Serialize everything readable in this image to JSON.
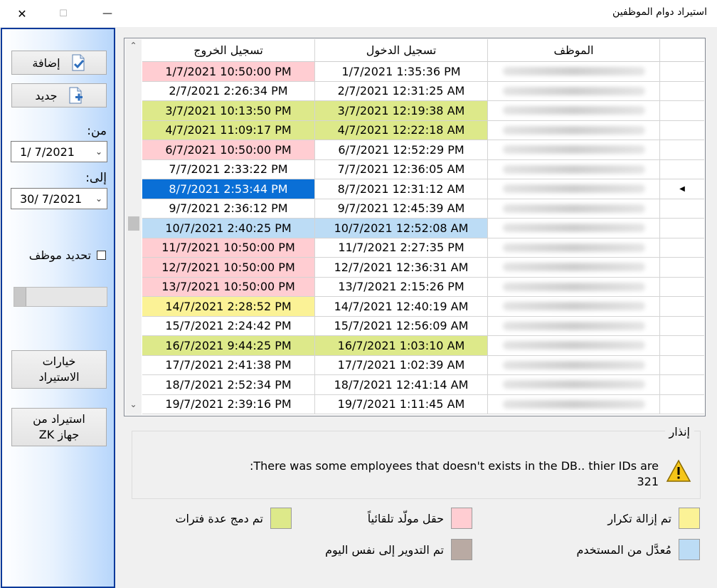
{
  "window": {
    "title": "استيراد دوام الموظفين"
  },
  "sidebar": {
    "add_label": "إضافة",
    "new_label": "جديد",
    "from_label": "من:",
    "from_date": "1/  7/2021",
    "to_label": "إلى:",
    "to_date": "30/  7/2021",
    "select_employee_label": "تحديد موظف",
    "progress_fraction": 0.12,
    "import_options_line1": "خيارات",
    "import_options_line2": "الاستيراد",
    "import_zk_line1": "استيراد من",
    "import_zk_line2": "جهاز ZK"
  },
  "grid": {
    "columns": {
      "out": "تسجيل الخروج",
      "in": "تسجيل الدخول",
      "employee": "الموظف"
    },
    "rows": [
      {
        "out": "1/7/2021 10:50:00 PM",
        "in": "1/7/2021 1:35:36 PM",
        "out_bg": "#ffcdd2",
        "in_bg": "#ffffff"
      },
      {
        "out": "2/7/2021 2:26:34 PM",
        "in": "2/7/2021 12:31:25 AM",
        "out_bg": "#ffffff",
        "in_bg": "#ffffff"
      },
      {
        "out": "3/7/2021 10:13:50 PM",
        "in": "3/7/2021 12:19:38 AM",
        "out_bg": "#dde98a",
        "in_bg": "#dde98a"
      },
      {
        "out": "4/7/2021 11:09:17 PM",
        "in": "4/7/2021 12:22:18 AM",
        "out_bg": "#dde98a",
        "in_bg": "#dde98a"
      },
      {
        "out": "6/7/2021 10:50:00 PM",
        "in": "6/7/2021 12:52:29 PM",
        "out_bg": "#ffcdd2",
        "in_bg": "#ffffff"
      },
      {
        "out": "7/7/2021 2:33:22 PM",
        "in": "7/7/2021 12:36:05 AM",
        "out_bg": "#ffffff",
        "in_bg": "#ffffff"
      },
      {
        "out": "8/7/2021 2:53:44 PM",
        "in": "8/7/2021 12:31:12 AM",
        "out_bg": "#0a6fd6",
        "in_bg": "#ffffff",
        "selected": true
      },
      {
        "out": "9/7/2021 2:36:12 PM",
        "in": "9/7/2021 12:45:39 AM",
        "out_bg": "#ffffff",
        "in_bg": "#ffffff"
      },
      {
        "out": "10/7/2021 2:40:25 PM",
        "in": "10/7/2021 12:52:08 AM",
        "out_bg": "#bcdcf5",
        "in_bg": "#bcdcf5"
      },
      {
        "out": "11/7/2021 10:50:00 PM",
        "in": "11/7/2021 2:27:35 PM",
        "out_bg": "#ffcdd2",
        "in_bg": "#ffffff"
      },
      {
        "out": "12/7/2021 10:50:00 PM",
        "in": "12/7/2021 12:36:31 AM",
        "out_bg": "#ffcdd2",
        "in_bg": "#ffffff"
      },
      {
        "out": "13/7/2021 10:50:00 PM",
        "in": "13/7/2021 2:15:26 PM",
        "out_bg": "#ffcdd2",
        "in_bg": "#ffffff"
      },
      {
        "out": "14/7/2021 2:28:52 PM",
        "in": "14/7/2021 12:40:19 AM",
        "out_bg": "#fbf296",
        "in_bg": "#ffffff"
      },
      {
        "out": "15/7/2021 2:24:42 PM",
        "in": "15/7/2021 12:56:09 AM",
        "out_bg": "#ffffff",
        "in_bg": "#ffffff"
      },
      {
        "out": "16/7/2021 9:44:25 PM",
        "in": "16/7/2021 1:03:10 AM",
        "out_bg": "#dde98a",
        "in_bg": "#dde98a"
      },
      {
        "out": "17/7/2021 2:41:38 PM",
        "in": "17/7/2021 1:02:39 AM",
        "out_bg": "#ffffff",
        "in_bg": "#ffffff"
      },
      {
        "out": "18/7/2021 2:52:34 PM",
        "in": "18/7/2021 12:41:14 AM",
        "out_bg": "#ffffff",
        "in_bg": "#ffffff"
      },
      {
        "out": "19/7/2021 2:39:16 PM",
        "in": "19/7/2021 1:11:45 AM",
        "out_bg": "#ffffff",
        "in_bg": "#ffffff"
      }
    ]
  },
  "warning": {
    "title": "إنذار",
    "message_line1": ":There was some employees that doesn't exists in the DB.. thier IDs are",
    "message_line2": "321"
  },
  "legend": {
    "duplicates_removed": {
      "label": "تم إزالة تكرار",
      "color": "#fbf296"
    },
    "auto_generated": {
      "label": "حقل مولّد تلقائياً",
      "color": "#ffcdd2"
    },
    "merged_periods": {
      "label": "تم دمج عدة فترات",
      "color": "#dde98a"
    },
    "user_modified": {
      "label": "مُعدَّل من المستخدم",
      "color": "#bcdcf5"
    },
    "rolled_same_day": {
      "label": "تم التدوير إلى نفس اليوم",
      "color": "#b9aaa3"
    }
  }
}
